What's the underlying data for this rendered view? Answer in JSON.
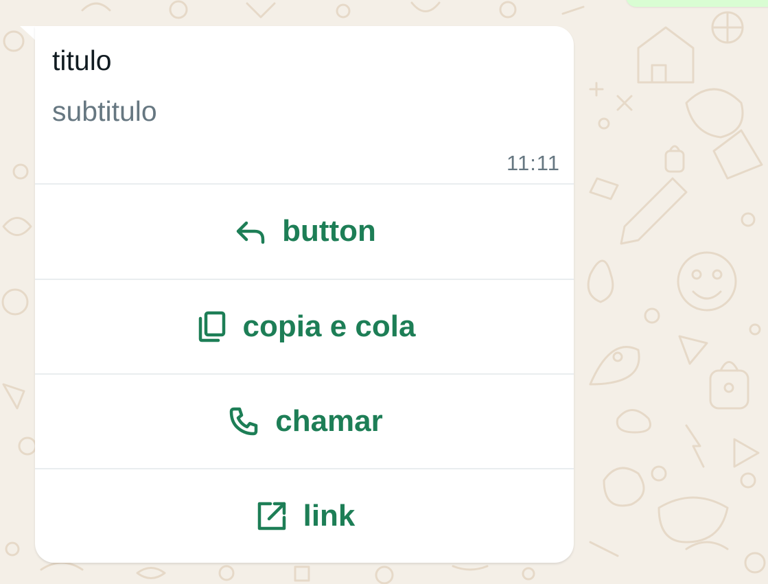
{
  "colors": {
    "wallpaper": "#f4efe7",
    "bubble": "#ffffff",
    "accent": "#1d7e56",
    "title_text": "#111b21",
    "secondary_text": "#667781",
    "outgoing_bubble": "#d9fdd3"
  },
  "message": {
    "title": "titulo",
    "subtitle": "subtitulo",
    "time": "11:11"
  },
  "actions": [
    {
      "label": "button",
      "icon": "reply-icon"
    },
    {
      "label": "copia e cola",
      "icon": "copy-icon"
    },
    {
      "label": "chamar",
      "icon": "phone-icon"
    },
    {
      "label": "link",
      "icon": "external-link-icon"
    }
  ]
}
